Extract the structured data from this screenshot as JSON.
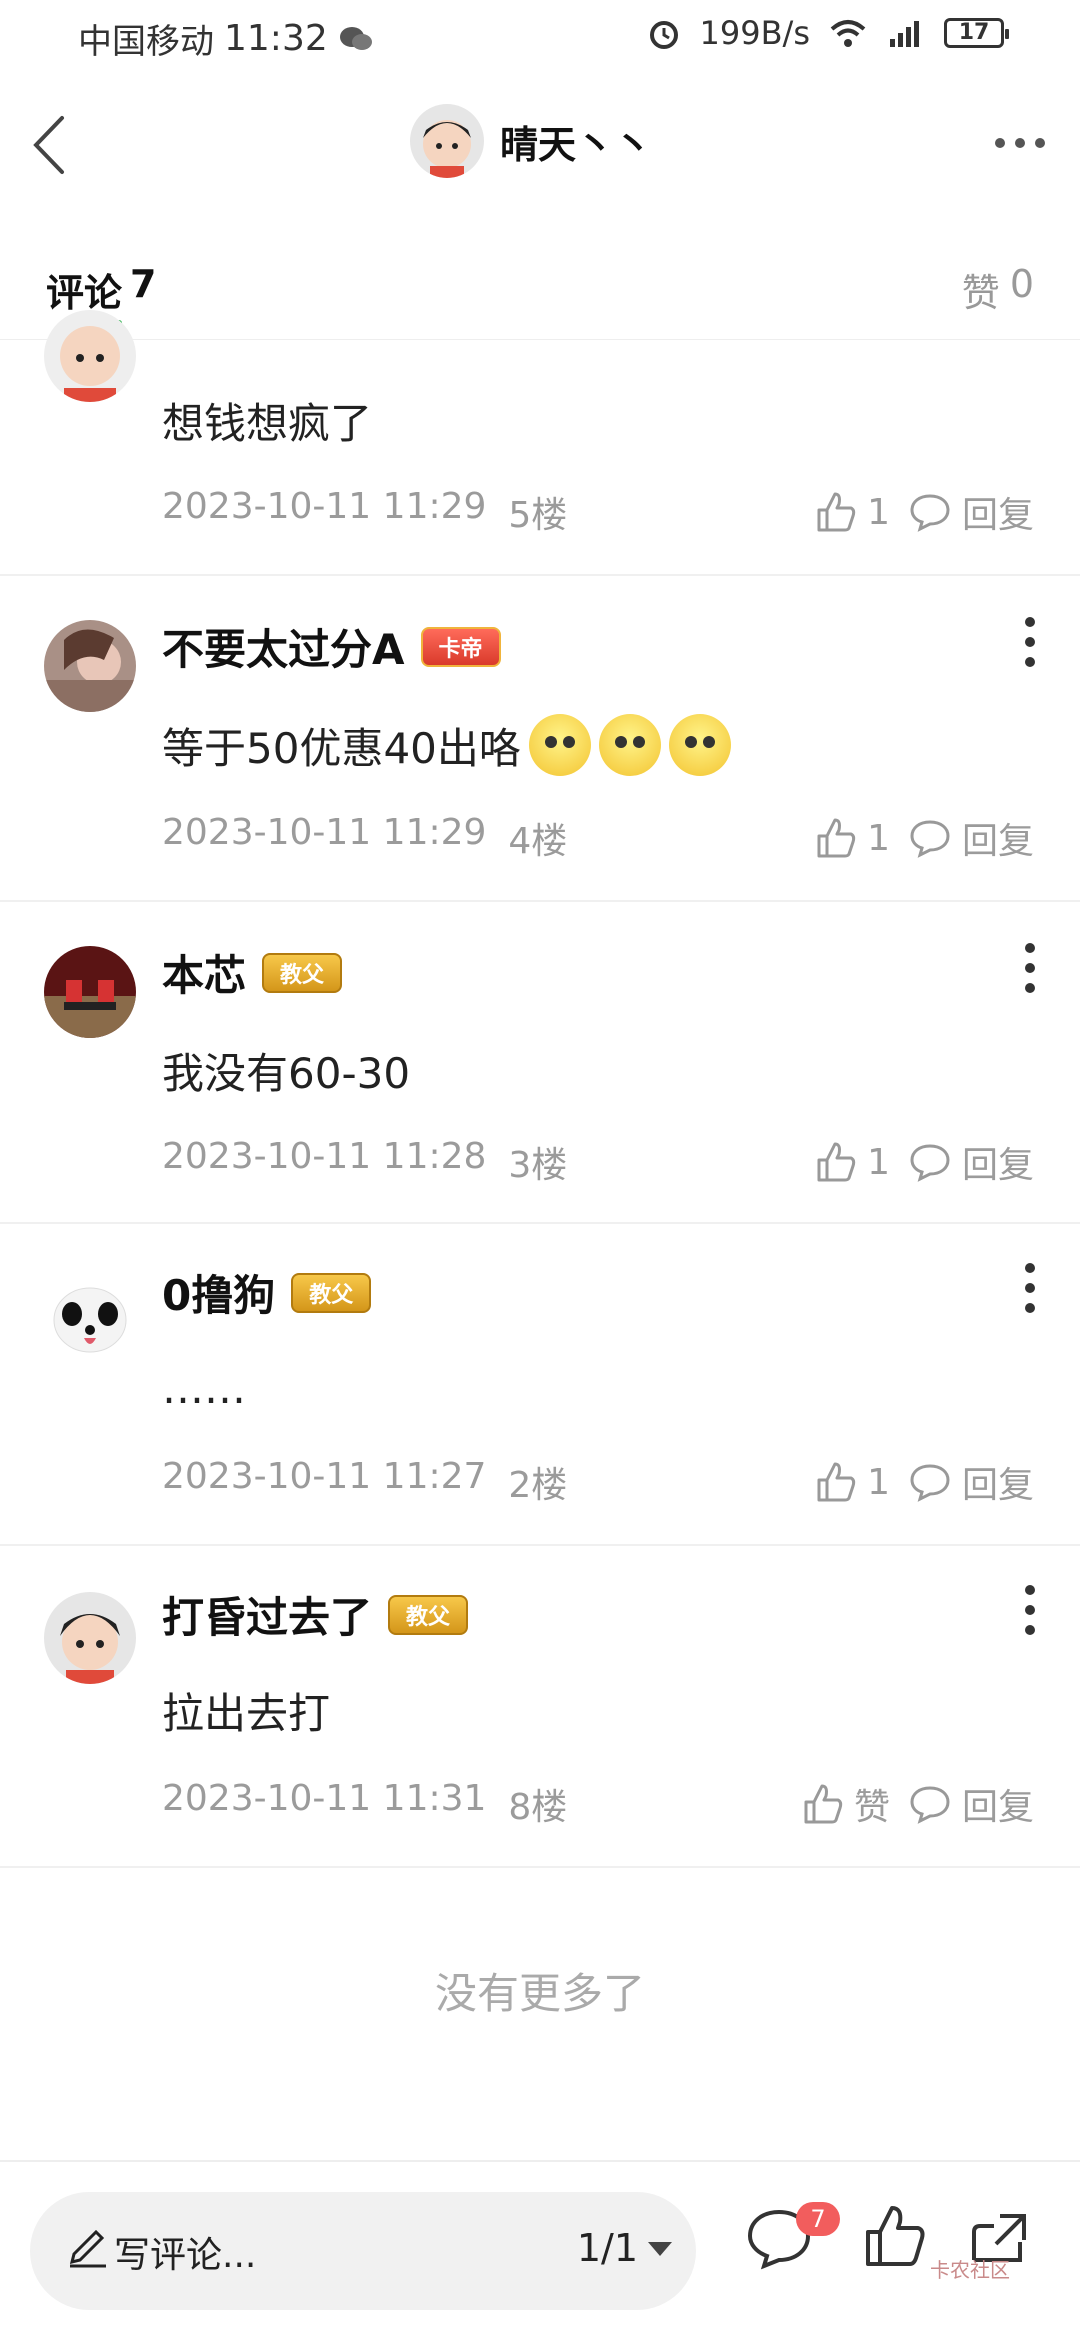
{
  "status": {
    "carrier": "中国移动",
    "time": "11:32",
    "speed": "199B/s",
    "network": "4G",
    "battery": "17"
  },
  "header": {
    "title": "晴天丶丶"
  },
  "tabs": {
    "comments_label": "评论",
    "comments_count": "7",
    "likes_label": "赞",
    "likes_count": "0"
  },
  "comments": [
    {
      "name": "",
      "text": "想钱想疯了",
      "date": "2023-10-11 11:29",
      "floor": "5楼",
      "likes": "1",
      "reply": "回复"
    },
    {
      "name": "不要太过分A",
      "badge": "卡帝",
      "text": "等于50优惠40出咯",
      "date": "2023-10-11 11:29",
      "floor": "4楼",
      "likes": "1",
      "reply": "回复"
    },
    {
      "name": "本芯",
      "badge": "教父",
      "text": "我没有60-30",
      "date": "2023-10-11 11:28",
      "floor": "3楼",
      "likes": "1",
      "reply": "回复"
    },
    {
      "name": "0撸狗",
      "badge": "教父",
      "text": "……",
      "date": "2023-10-11 11:27",
      "floor": "2楼",
      "likes": "1",
      "reply": "回复"
    },
    {
      "name": "打昏过去了",
      "badge": "教父",
      "text": "拉出去打",
      "date": "2023-10-11 11:31",
      "floor": "8楼",
      "likes": "赞",
      "reply": "回复"
    }
  ],
  "end_text": "没有更多了",
  "bottom": {
    "placeholder": "写评论...",
    "page": "1/1",
    "comment_count": "7",
    "watermark": "卡农社区"
  },
  "colors": {
    "accent": "#2bb24c",
    "badge_red": "#f25d5d",
    "gold_badge": "#d4961a"
  }
}
